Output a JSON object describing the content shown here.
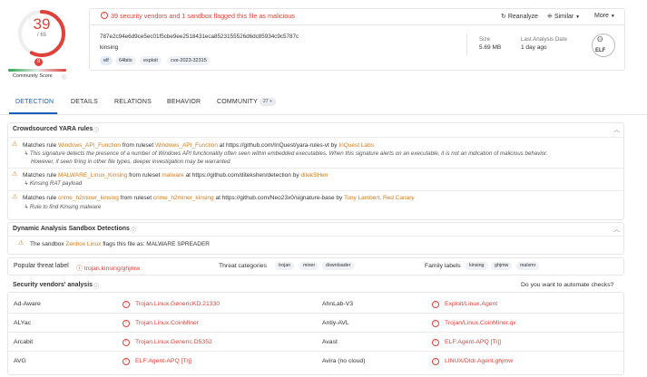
{
  "score": {
    "value": "39",
    "total": "/ 65",
    "label": "Community Score",
    "pin": "8",
    "color": "#e0413a"
  },
  "header": {
    "alert": "39 security vendors and 1 sandbox flagged this file as malicious",
    "actions": {
      "reanalyze": "Reanalyze",
      "similar": "Similar",
      "more": "More"
    },
    "sha256": "787e2c94e6d9ce5ec01f5cbe9ee2518431eca8523155526d6dc85934c9c5787c",
    "file_name": "kinsing",
    "tags": [
      "elf",
      "64bits",
      "exploit",
      "cve-2023-32315"
    ],
    "size_label": "Size",
    "size_value": "5.69 MB",
    "last_label": "Last Analysis Date",
    "last_value": "1 day ago",
    "file_type": "ELF"
  },
  "tabs": [
    "DETECTION",
    "DETAILS",
    "RELATIONS",
    "BEHAVIOR",
    "COMMUNITY"
  ],
  "community_count": "27 +",
  "yara": {
    "title": "Crowdsourced YARA rules",
    "rules": [
      {
        "pre": "Matches rule ",
        "rule": "Windows_API_Function",
        "mid": " from ruleset ",
        "ruleset": "Windows_API_Function",
        "at": " at https://github.com/InQuest/yara-rules-vt by ",
        "author": "InQuest Labs",
        "desc1": "This signature detects the presence of a number of Windows API functionality often seen within embedded executables. When this signature alerts on an executable, it is not an indication of malicious behavior.",
        "desc2": "However, if seen firing in other file types, deeper investigation may be warranted."
      },
      {
        "pre": "Matches rule ",
        "rule": "MALWARE_Linux_Kinsing",
        "mid": " from ruleset ",
        "ruleset": "malware",
        "at": " at https://github.com/ditekshen/detection by ",
        "author": "ditekSHen",
        "desc1": "Kinsing RAT payload",
        "desc2": ""
      },
      {
        "pre": "Matches rule ",
        "rule": "crime_h2miner_kinsing",
        "mid": " from ruleset ",
        "ruleset": "crime_h2miner_kinsing",
        "at": " at https://github.com/Neo23x0/signature-base by ",
        "author": "Tony Lambert, Red Canary",
        "desc1": "Rule to find Kinsing malware",
        "desc2": ""
      }
    ]
  },
  "sandbox": {
    "title": "Dynamic Analysis Sandbox Detections",
    "pre": "The sandbox ",
    "name": "Zenbox Linux",
    "post": " flags this file as: MALWARE SPREADER"
  },
  "threat": {
    "popular_label": "Popular threat label",
    "popular_value": "trojan.kinsing/ghjmw",
    "categories_label": "Threat categories",
    "categories": [
      "trojan",
      "miner",
      "downloader"
    ],
    "family_label": "Family labels",
    "families": [
      "kinsing",
      "ghjmw",
      "malxmr"
    ]
  },
  "vendors": {
    "title": "Security vendors' analysis",
    "automate": "Do you want to automate checks?",
    "rows": [
      {
        "l_name": "Ad-Aware",
        "l_res": "Trojan.Linux.GenericKD.21330",
        "r_name": "AhnLab-V3",
        "r_res": "Exploit/Linux.Agent"
      },
      {
        "l_name": "ALYac",
        "l_res": "Trojan.Linux.CoinMiner",
        "r_name": "Antiy-AVL",
        "r_res": "Trojan/Linux.CoinMiner.qx"
      },
      {
        "l_name": "Arcabit",
        "l_res": "Trojan.Linux.Generic.D5352",
        "r_name": "Avast",
        "r_res": "ELF:Agent-APQ [Trj]"
      },
      {
        "l_name": "AVG",
        "l_res": "ELF:Agent-APQ [Trj]",
        "r_name": "Avira (no cloud)",
        "r_res": "LINUX/Dldr.Agent.ghjmw"
      }
    ]
  },
  "colors": {
    "accent": "#1a5cba",
    "danger": "#e0413a",
    "link": "#d97a1e"
  }
}
